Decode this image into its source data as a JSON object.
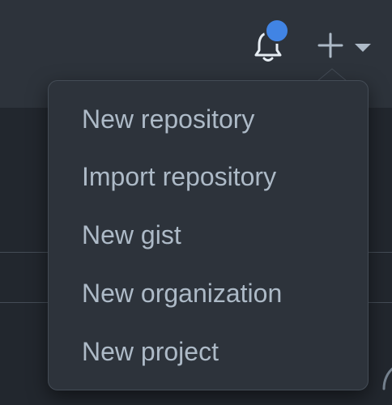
{
  "header": {
    "notifications": {
      "icon": "bell-icon",
      "has_unread": true,
      "dot_color": "#4184e4"
    },
    "create_button": {
      "icon": "plus-icon",
      "dropdown_icon": "triangle-down-icon"
    }
  },
  "menu": {
    "items": [
      {
        "label": "New repository"
      },
      {
        "label": "Import repository"
      },
      {
        "label": "New gist"
      },
      {
        "label": "New organization"
      },
      {
        "label": "New project"
      }
    ]
  },
  "colors": {
    "page_bg": "#22272e",
    "header_bg": "#2d333b",
    "menu_bg": "#2d333b",
    "border": "#444c56",
    "text": "#adbac7",
    "accent": "#4184e4"
  }
}
